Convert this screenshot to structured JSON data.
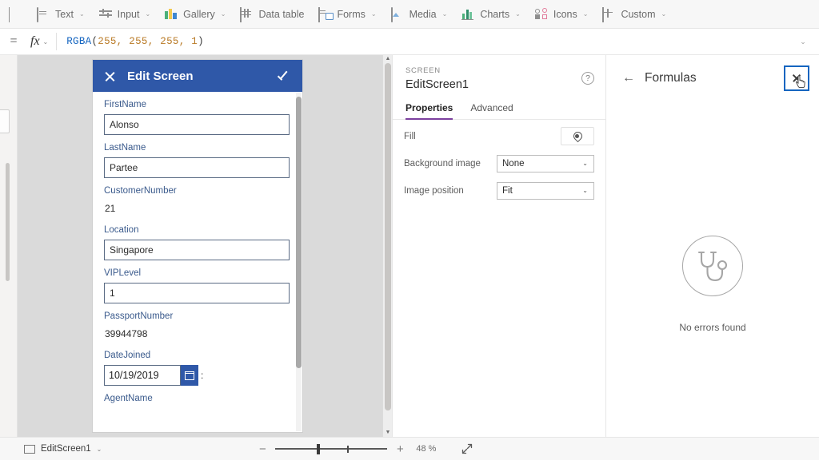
{
  "toolbar": {
    "items": [
      {
        "label": "",
        "icon": "partial-icon"
      },
      {
        "label": "Text",
        "icon": "text-icon"
      },
      {
        "label": "Input",
        "icon": "input-icon"
      },
      {
        "label": "Gallery",
        "icon": "gallery-icon"
      },
      {
        "label": "Data table",
        "icon": "data-table-icon"
      },
      {
        "label": "Forms",
        "icon": "forms-icon"
      },
      {
        "label": "Media",
        "icon": "media-icon"
      },
      {
        "label": "Charts",
        "icon": "charts-icon"
      },
      {
        "label": "Icons",
        "icon": "icons-icon"
      },
      {
        "label": "Custom",
        "icon": "custom-icon"
      }
    ],
    "chevron": "⌄"
  },
  "formula_bar": {
    "equals": "=",
    "fx": "fx",
    "fx_chevron": "⌄",
    "expression_function": "RGBA",
    "expression_open": "(",
    "expression_values": "255, 255, 255, 1",
    "expression_close": ")",
    "expand_chevron": "⌄"
  },
  "canvas": {
    "form": {
      "header": {
        "close_icon": "close-icon",
        "title": "Edit Screen",
        "confirm_icon": "check-icon"
      },
      "fields": [
        {
          "label": "FirstName",
          "value": "Alonso",
          "type": "input"
        },
        {
          "label": "LastName",
          "value": "Partee",
          "type": "input"
        },
        {
          "label": "CustomerNumber",
          "value": "21",
          "type": "static"
        },
        {
          "label": "Location",
          "value": "Singapore",
          "type": "input"
        },
        {
          "label": "VIPLevel",
          "value": "1",
          "type": "input"
        },
        {
          "label": "PassportNumber",
          "value": "39944798",
          "type": "static"
        },
        {
          "label": "DateJoined",
          "value": "10/19/2019",
          "type": "date"
        },
        {
          "label": "AgentName",
          "value": "",
          "type": "label-only"
        }
      ],
      "date_suffix": ":"
    }
  },
  "properties_panel": {
    "kicker": "SCREEN",
    "title": "EditScreen1",
    "help_icon": "?",
    "tabs": [
      {
        "label": "Properties",
        "active": true
      },
      {
        "label": "Advanced",
        "active": false
      }
    ],
    "rows": [
      {
        "label": "Fill",
        "control": "color",
        "value": ""
      },
      {
        "label": "Background image",
        "control": "select",
        "value": "None"
      },
      {
        "label": "Image position",
        "control": "select",
        "value": "Fit"
      }
    ],
    "select_chevron": "⌄"
  },
  "formulas_panel": {
    "back_arrow": "←",
    "title": "Formulas",
    "close_icon": "close-icon",
    "empty_icon": "stethoscope-icon",
    "empty_text": "No errors found"
  },
  "status_bar": {
    "screen_name": "EditScreen1",
    "screen_chevron": "⌄",
    "zoom_out": "−",
    "zoom_in": "+",
    "zoom_value": "48",
    "zoom_unit": "%",
    "expand_icon": "expand-icon"
  },
  "colors": {
    "form_header_blue": "#2f58a8",
    "tab_accent_purple": "#7c3f9e",
    "focus_blue": "#1565c0",
    "formula_function": "#1565c0",
    "formula_number": "#b97a26",
    "field_label": "#3a5a8c",
    "canvas_bg": "#dadada"
  }
}
